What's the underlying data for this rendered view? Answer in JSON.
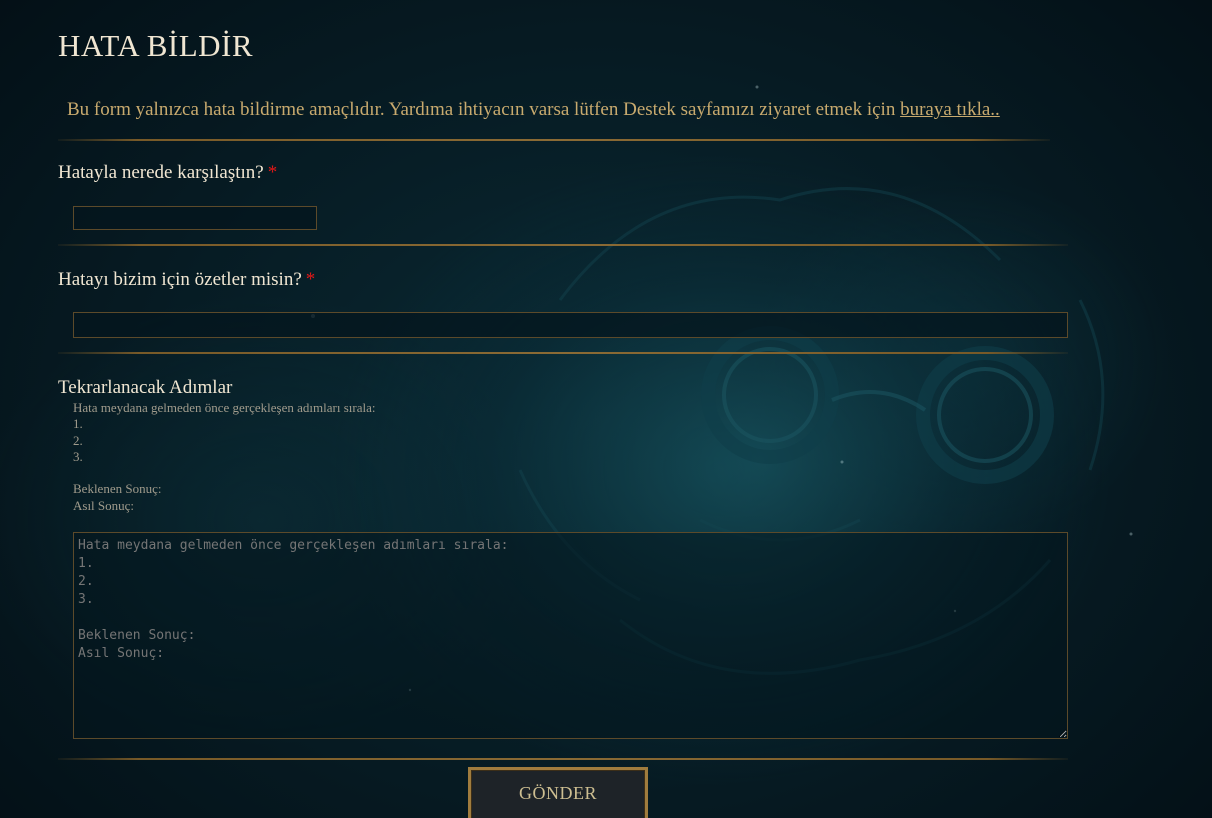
{
  "page": {
    "title": "HATA BİLDİR",
    "intro_text": "Bu form yalnızca hata bildirme amaçlıdır. Yardıma ihtiyacın varsa lütfen Destek sayfamızı ziyaret etmek için ",
    "intro_link": "buraya tıkla.."
  },
  "form": {
    "where_label": "Hatayla nerede karşılaştın?",
    "where_value": "",
    "summary_label": "Hatayı bizim için özetler misin?",
    "summary_value": "",
    "required_mark": "*",
    "steps": {
      "title": "Tekrarlanacak Adımlar",
      "help_lines": [
        "Hata meydana gelmeden önce gerçekleşen adımları sırala:",
        "1.",
        "2.",
        "3.",
        "",
        "Beklenen Sonuç:",
        "Asıl Sonuç:"
      ],
      "placeholder": "Hata meydana gelmeden önce gerçekleşen adımları sırala:\n1.\n2.\n3.\n\nBeklenen Sonuç:\nAsıl Sonuç:"
    },
    "submit_label": "GÖNDER"
  },
  "colors": {
    "gold": "#c8aa6e",
    "cream": "#f0e6d2",
    "required_red": "#e01818",
    "background": "#04121a"
  }
}
